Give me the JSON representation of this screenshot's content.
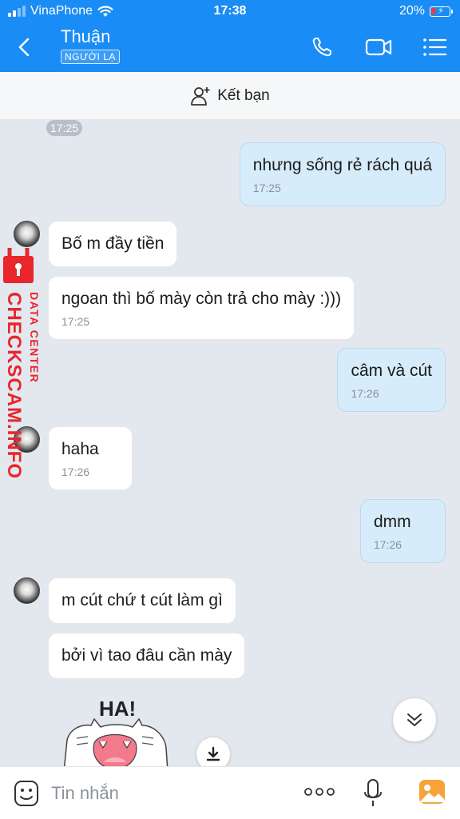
{
  "status_bar": {
    "carrier": "VinaPhone",
    "time": "17:38",
    "battery": "20%"
  },
  "header": {
    "contact_name": "Thuận",
    "badge": "NGƯỜI LẠ"
  },
  "add_friend": {
    "label": "Kết bạn"
  },
  "watermark": {
    "line1": "DATA CENTER",
    "line2": "CHECKSCAM.INFO"
  },
  "messages": [
    {
      "type": "time",
      "text": "17:25"
    },
    {
      "direction": "out",
      "text": "nhưng sống rẻ rách quá",
      "time": "17:25"
    },
    {
      "direction": "in",
      "text": "Bố m đầy tiền",
      "time": ""
    },
    {
      "direction": "in",
      "text": "ngoan thì bố mày còn trả cho mày :)))",
      "time": "17:25"
    },
    {
      "direction": "out",
      "text": "câm và cút",
      "time": "17:26"
    },
    {
      "direction": "in",
      "text": "haha",
      "time": "17:26"
    },
    {
      "direction": "out",
      "text": "dmm",
      "time": "17:26"
    },
    {
      "direction": "in",
      "text": "m cút chứ t cút làm gì",
      "time": ""
    },
    {
      "direction": "in",
      "text": "bởi vì tao đâu cần mày",
      "time": ""
    }
  ],
  "sticker": {
    "text": "HA!"
  },
  "input": {
    "placeholder": "Tin nhắn"
  },
  "colors": {
    "header": "#1a8cf5",
    "outgoing_bubble": "#d6ecfb",
    "incoming_bubble": "#ffffff",
    "chat_background": "#e3e8ef",
    "watermark": "#e8262c"
  }
}
